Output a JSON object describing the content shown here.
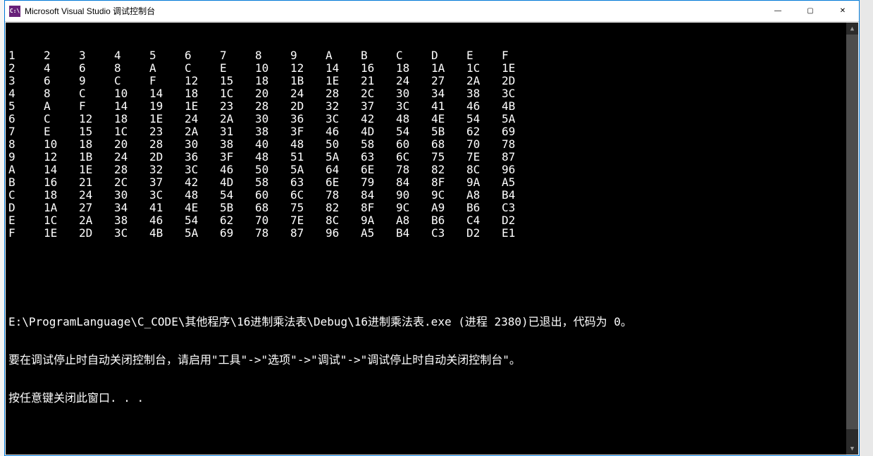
{
  "window": {
    "icon_text": "C:\\",
    "title": "Microsoft Visual Studio 调试控制台",
    "minimize": "—",
    "maximize": "▢",
    "close": "✕"
  },
  "table": {
    "rows": [
      [
        "1",
        "2",
        "3",
        "4",
        "5",
        "6",
        "7",
        "8",
        "9",
        "A",
        "B",
        "C",
        "D",
        "E",
        "F"
      ],
      [
        "2",
        "4",
        "6",
        "8",
        "A",
        "C",
        "E",
        "10",
        "12",
        "14",
        "16",
        "18",
        "1A",
        "1C",
        "1E"
      ],
      [
        "3",
        "6",
        "9",
        "C",
        "F",
        "12",
        "15",
        "18",
        "1B",
        "1E",
        "21",
        "24",
        "27",
        "2A",
        "2D"
      ],
      [
        "4",
        "8",
        "C",
        "10",
        "14",
        "18",
        "1C",
        "20",
        "24",
        "28",
        "2C",
        "30",
        "34",
        "38",
        "3C"
      ],
      [
        "5",
        "A",
        "F",
        "14",
        "19",
        "1E",
        "23",
        "28",
        "2D",
        "32",
        "37",
        "3C",
        "41",
        "46",
        "4B"
      ],
      [
        "6",
        "C",
        "12",
        "18",
        "1E",
        "24",
        "2A",
        "30",
        "36",
        "3C",
        "42",
        "48",
        "4E",
        "54",
        "5A"
      ],
      [
        "7",
        "E",
        "15",
        "1C",
        "23",
        "2A",
        "31",
        "38",
        "3F",
        "46",
        "4D",
        "54",
        "5B",
        "62",
        "69"
      ],
      [
        "8",
        "10",
        "18",
        "20",
        "28",
        "30",
        "38",
        "40",
        "48",
        "50",
        "58",
        "60",
        "68",
        "70",
        "78"
      ],
      [
        "9",
        "12",
        "1B",
        "24",
        "2D",
        "36",
        "3F",
        "48",
        "51",
        "5A",
        "63",
        "6C",
        "75",
        "7E",
        "87"
      ],
      [
        "A",
        "14",
        "1E",
        "28",
        "32",
        "3C",
        "46",
        "50",
        "5A",
        "64",
        "6E",
        "78",
        "82",
        "8C",
        "96"
      ],
      [
        "B",
        "16",
        "21",
        "2C",
        "37",
        "42",
        "4D",
        "58",
        "63",
        "6E",
        "79",
        "84",
        "8F",
        "9A",
        "A5"
      ],
      [
        "C",
        "18",
        "24",
        "30",
        "3C",
        "48",
        "54",
        "60",
        "6C",
        "78",
        "84",
        "90",
        "9C",
        "A8",
        "B4"
      ],
      [
        "D",
        "1A",
        "27",
        "34",
        "41",
        "4E",
        "5B",
        "68",
        "75",
        "82",
        "8F",
        "9C",
        "A9",
        "B6",
        "C3"
      ],
      [
        "E",
        "1C",
        "2A",
        "38",
        "46",
        "54",
        "62",
        "70",
        "7E",
        "8C",
        "9A",
        "A8",
        "B6",
        "C4",
        "D2"
      ],
      [
        "F",
        "1E",
        "2D",
        "3C",
        "4B",
        "5A",
        "69",
        "78",
        "87",
        "96",
        "A5",
        "B4",
        "C3",
        "D2",
        "E1"
      ]
    ]
  },
  "messages": {
    "line1": "E:\\ProgramLanguage\\C_CODE\\其他程序\\16进制乘法表\\Debug\\16进制乘法表.exe (进程 2380)已退出，代码为 0。",
    "line2": "要在调试停止时自动关闭控制台，请启用\"工具\"->\"选项\"->\"调试\"->\"调试停止时自动关闭控制台\"。",
    "line3": "按任意键关闭此窗口. . ."
  }
}
